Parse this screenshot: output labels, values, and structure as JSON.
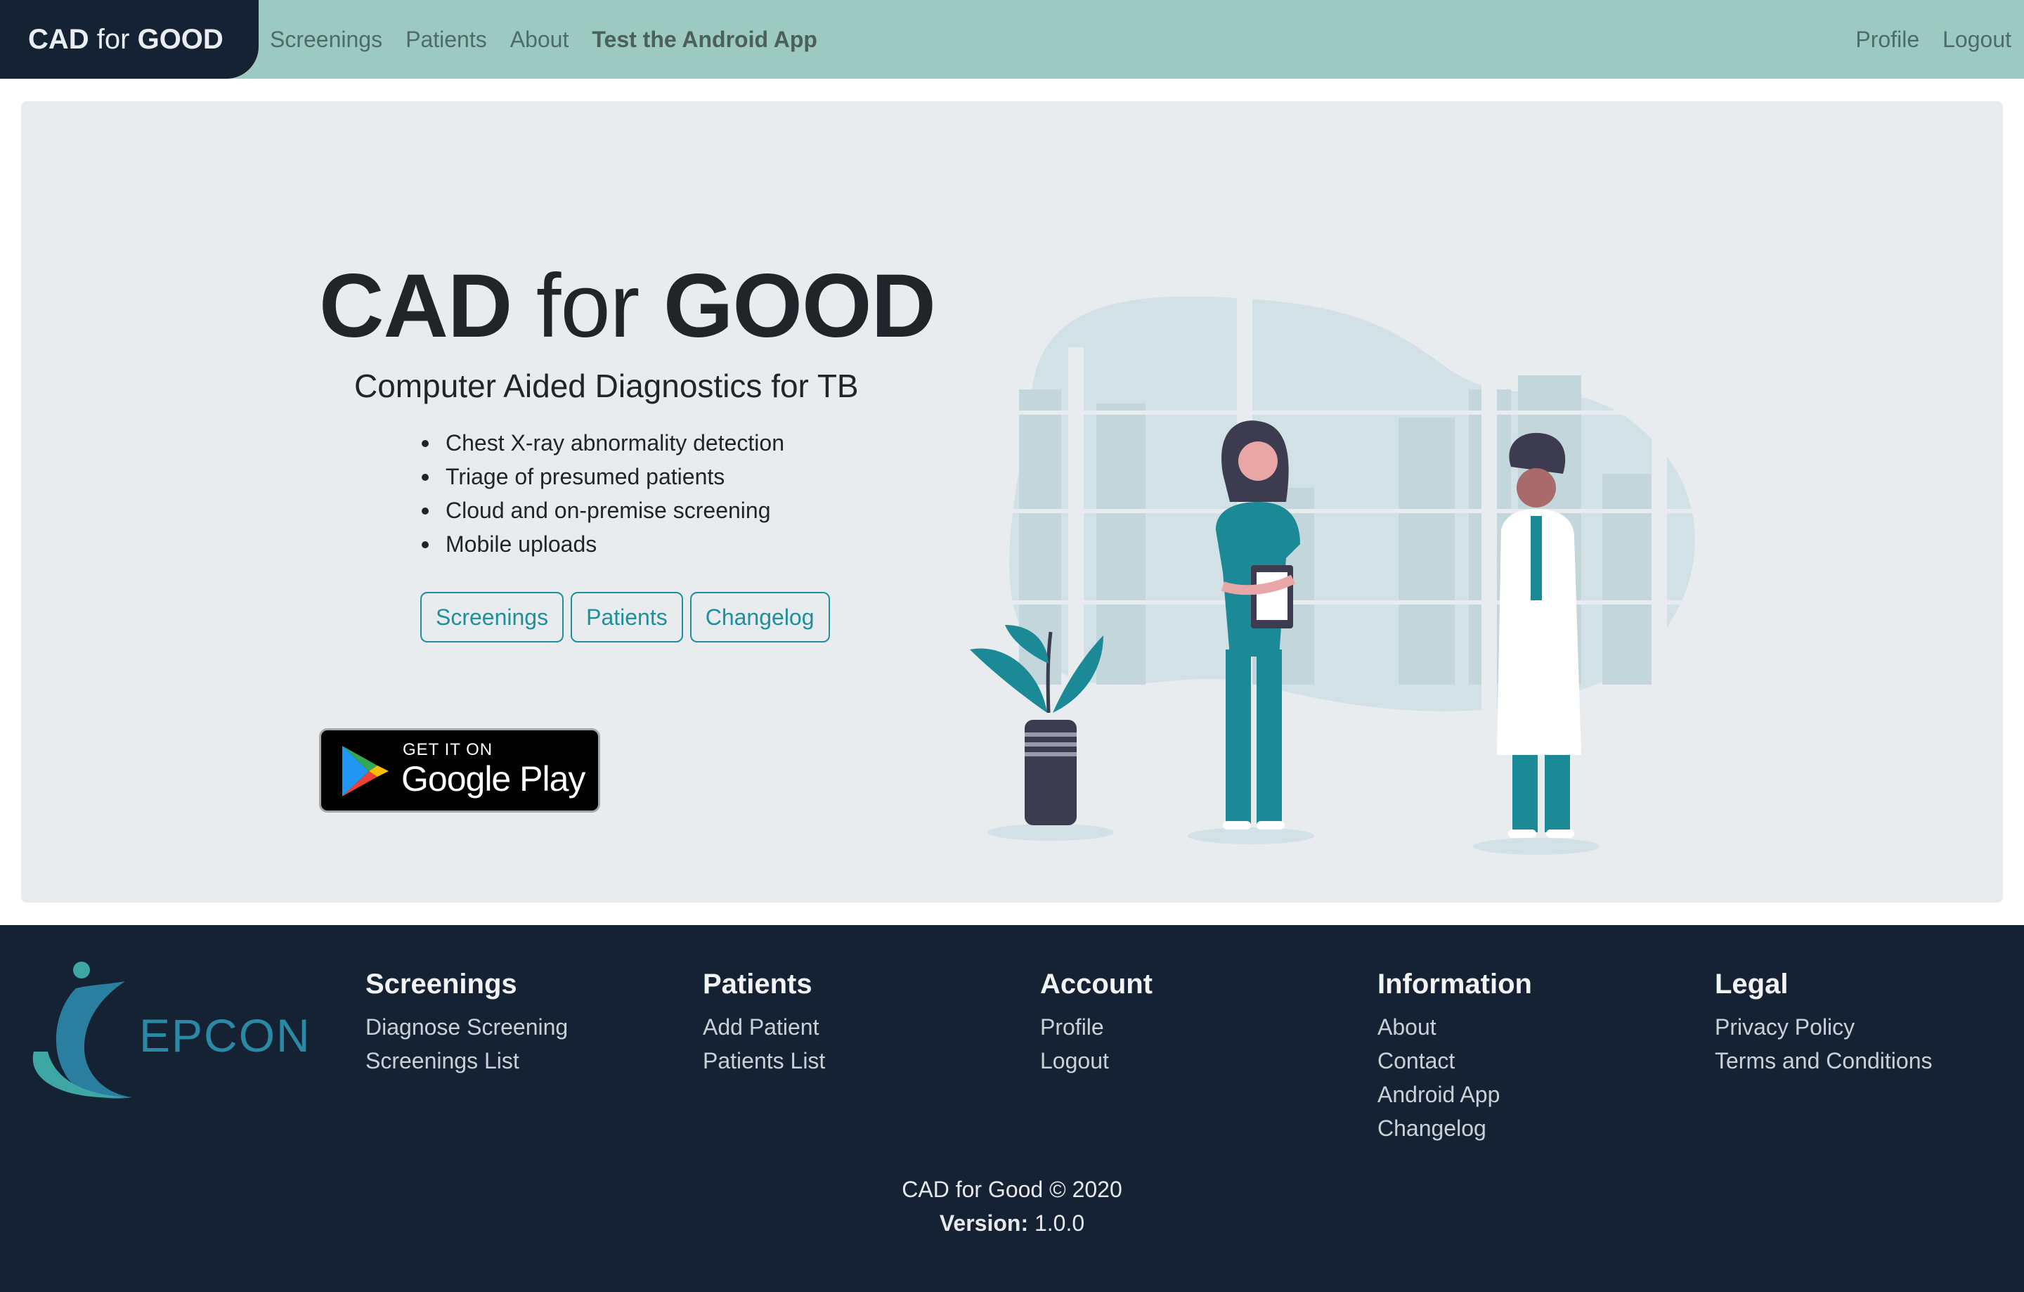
{
  "navbar": {
    "brand_prefix": "CAD",
    "brand_middle": " for ",
    "brand_suffix": "GOOD",
    "links": [
      "Screenings",
      "Patients",
      "About"
    ],
    "highlight_link": "Test the Android App",
    "right_links": [
      "Profile",
      "Logout"
    ],
    "brand_color": "#152233",
    "bar_color": "#9ccac0"
  },
  "hero": {
    "title_a": "CAD",
    "title_b": " for ",
    "title_c": "GOOD",
    "subtitle": "Computer Aided Diagnostics for TB",
    "features": [
      "Chest X-ray abnormality detection",
      "Triage of presumed patients",
      "Cloud and on-premise screening",
      "Mobile uploads"
    ],
    "buttons": [
      "Screenings",
      "Patients",
      "Changelog"
    ],
    "badge_small": "GET IT ON",
    "badge_big": "Google Play",
    "accent_color": "#1f8f9a",
    "illustration_icon": "doctors-illustration"
  },
  "footer": {
    "logo_text": "EPCON",
    "columns": [
      {
        "title": "Screenings",
        "links": [
          "Diagnose Screening",
          "Screenings List"
        ]
      },
      {
        "title": "Patients",
        "links": [
          "Add Patient",
          "Patients List"
        ]
      },
      {
        "title": "Account",
        "links": [
          "Profile",
          "Logout"
        ]
      },
      {
        "title": "Information",
        "links": [
          "About",
          "Contact",
          "Android App",
          "Changelog"
        ]
      },
      {
        "title": "Legal",
        "links": [
          "Privacy Policy",
          "Terms and Conditions"
        ]
      }
    ],
    "copyright": "CAD for Good © 2020",
    "version_label": "Version:",
    "version_value": " 1.0.0"
  }
}
